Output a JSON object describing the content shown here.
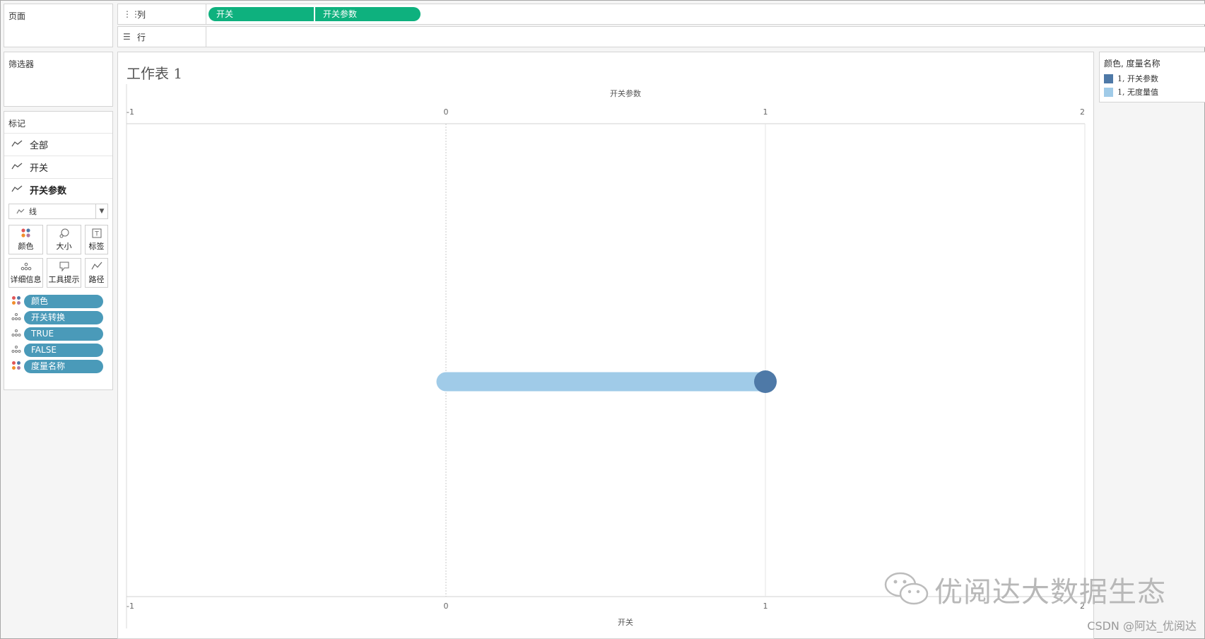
{
  "shelves": {
    "pages_label": "页面",
    "columns": {
      "label": "列",
      "pills": [
        "开关",
        "开关参数"
      ]
    },
    "rows": {
      "label": "行"
    }
  },
  "filters": {
    "label": "筛选器"
  },
  "marks": {
    "label": "标记",
    "rows": [
      {
        "label": "全部",
        "active": false
      },
      {
        "label": "开关",
        "active": false
      },
      {
        "label": "开关参数",
        "active": true
      }
    ],
    "mark_type": {
      "label": "线",
      "icon": "line-chart-icon"
    },
    "cards": [
      {
        "label": "颜色",
        "icon": "color-dots-icon"
      },
      {
        "label": "大小",
        "icon": "size-icon"
      },
      {
        "label": "标签",
        "icon": "label-icon"
      },
      {
        "label": "详细信息",
        "icon": "detail-dots-icon"
      },
      {
        "label": "工具提示",
        "icon": "tooltip-icon"
      },
      {
        "label": "路径",
        "icon": "path-icon"
      }
    ],
    "pills": [
      {
        "label": "颜色",
        "role": "color"
      },
      {
        "label": "开关转换",
        "role": "detail"
      },
      {
        "label": "TRUE",
        "role": "detail"
      },
      {
        "label": "FALSE",
        "role": "detail"
      },
      {
        "label": "度量名称",
        "role": "color"
      }
    ]
  },
  "sheet": {
    "title": "工作表 1"
  },
  "legend": {
    "title": "颜色, 度量名称",
    "items": [
      {
        "label": "1, 开关参数",
        "color": "#4e79a7"
      },
      {
        "label": "1, 无度量值",
        "color": "#a0cbe8"
      }
    ]
  },
  "chart_data": {
    "type": "line",
    "top_axis": {
      "label": "开关参数",
      "range": [
        -1,
        2
      ],
      "ticks": [
        "-1",
        "0",
        "1",
        "2"
      ]
    },
    "bottom_axis": {
      "label": "开关",
      "range": [
        -1,
        2
      ],
      "ticks": [
        "-1",
        "0",
        "1",
        "2"
      ]
    },
    "series": [
      {
        "name": "1, 无度量值",
        "color": "#a0cbe8",
        "x": [
          0,
          1
        ],
        "y": [
          0,
          0
        ]
      },
      {
        "name": "1, 开关参数",
        "color": "#4e79a7",
        "x": [
          1
        ],
        "y": [
          0
        ]
      }
    ],
    "gridlines_x": [
      0,
      1
    ]
  },
  "watermark": {
    "text": "优阅达大数据生态",
    "icon": "wechat-icon"
  },
  "csdn_mark": "CSDN @阿达_优阅达"
}
